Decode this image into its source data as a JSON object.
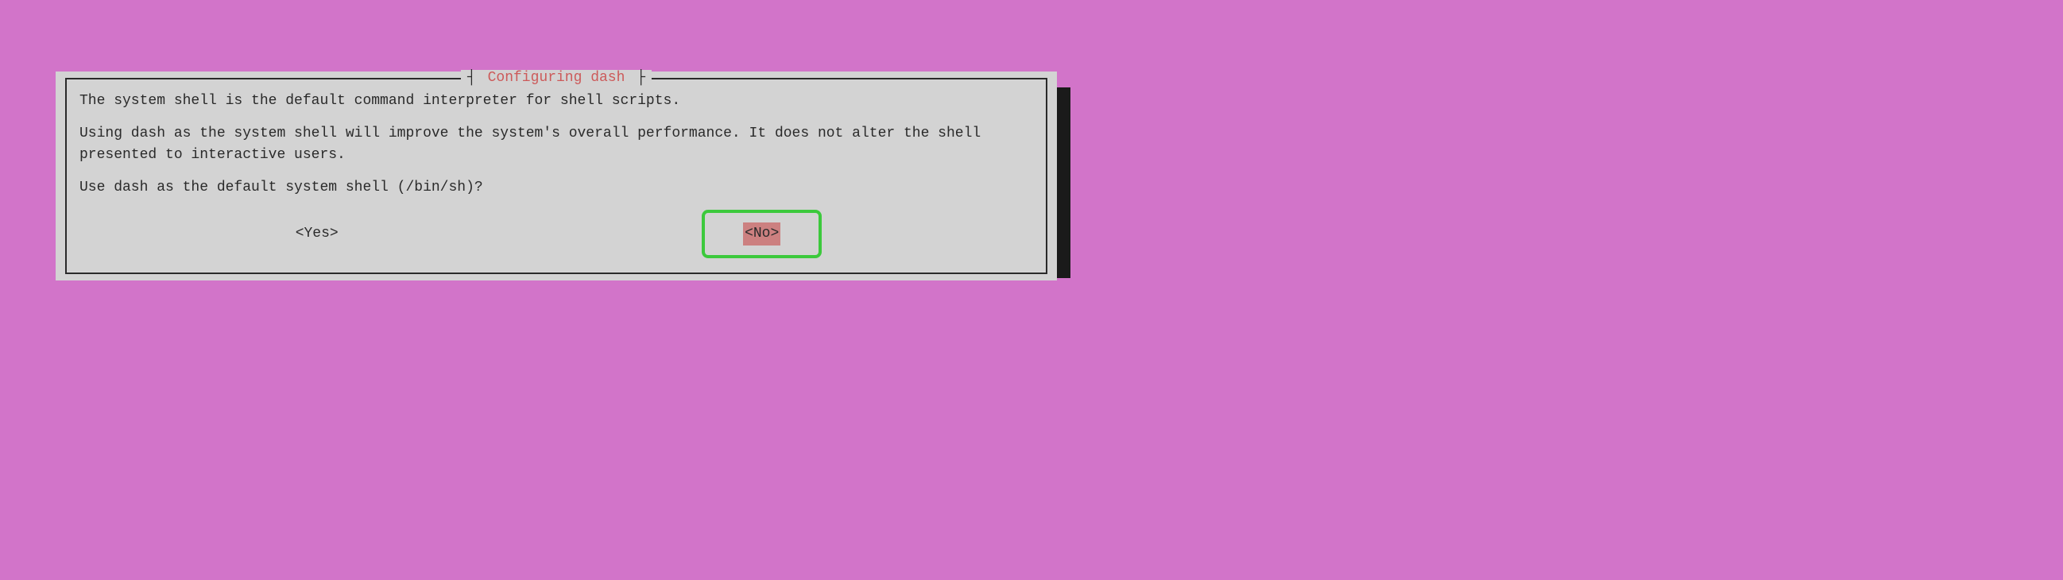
{
  "dialog": {
    "title": "Configuring dash",
    "line1": "The system shell is the default command interpreter for shell scripts.",
    "line2": "Using dash as the system shell will improve the system's overall performance. It does not alter the shell presented to interactive users.",
    "line3": "Use dash as the default system shell (/bin/sh)?",
    "buttons": {
      "yes": "<Yes>",
      "no": "<No>"
    },
    "selected": "no"
  }
}
